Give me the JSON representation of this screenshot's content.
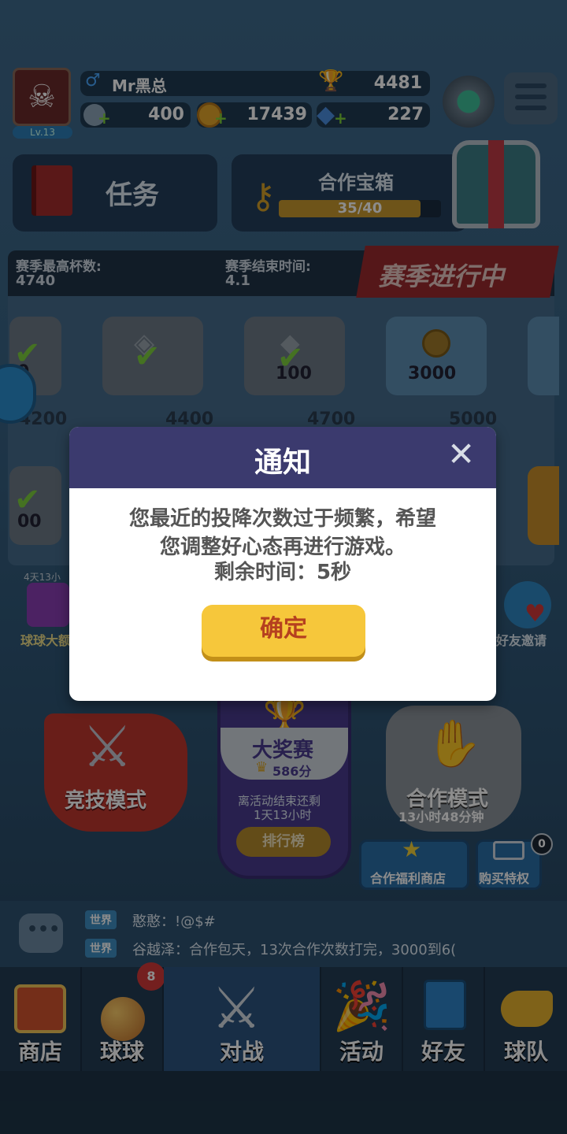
{
  "player": {
    "name": "Mr黑总",
    "level": "Lv.13",
    "trophies": "4481",
    "stat1": "400",
    "coins": "17439",
    "gems": "227"
  },
  "tasks": {
    "label": "任务"
  },
  "coop_chest": {
    "title": "合作宝箱",
    "progress_text": "35/40",
    "progress": 0.875
  },
  "season": {
    "best_label": "赛季最高杯数:",
    "best_value": "4740",
    "end_label": "赛季结束时间:",
    "end_value": "4.1",
    "banner": "赛季进行中"
  },
  "rewards_row1": [
    {
      "value": "0"
    },
    {
      "value": ""
    },
    {
      "value": "100"
    },
    {
      "value": "3000"
    }
  ],
  "reward_thresholds": [
    "4200",
    "4400",
    "4700",
    "5000"
  ],
  "rewards_row2": [
    {
      "value": "00"
    }
  ],
  "events": {
    "left_timer": "4天13小",
    "left_label": "球球大额",
    "right_label": "好友邀请"
  },
  "modes": {
    "competitive": "竞技模式",
    "grand_prix": {
      "title": "大奖赛",
      "score": "586分",
      "ends_label": "离活动结束还剩",
      "ends_value": "1天13小时",
      "rank_btn": "排行榜"
    },
    "coop": {
      "title": "合作模式",
      "timer": "13小时48分钟"
    }
  },
  "shop_buttons": {
    "coop_shop": "合作福利商店",
    "buy_priv": "购买特权",
    "badge": "0"
  },
  "chat": [
    {
      "channel": "世界",
      "text": "憨憨：!@$#"
    },
    {
      "channel": "世界",
      "text": "谷越泽：合作包天，13次合作次数打完，3000到6("
    }
  ],
  "nav": [
    {
      "label": "商店"
    },
    {
      "label": "球球",
      "badge": "8"
    },
    {
      "label": "对战"
    },
    {
      "label": "活动"
    },
    {
      "label": "好友"
    },
    {
      "label": "球队"
    }
  ],
  "dialog": {
    "title": "通知",
    "message_line1": "您最近的投降次数过于频繁，希望",
    "message_line2": "您调整好心态再进行游戏。",
    "remaining_label": "剩余时间：5秒",
    "confirm": "确定"
  },
  "colors": {
    "dialog_header": "#3b3a6e",
    "confirm_btn": "#f6c73b",
    "confirm_text": "#b5401f"
  }
}
